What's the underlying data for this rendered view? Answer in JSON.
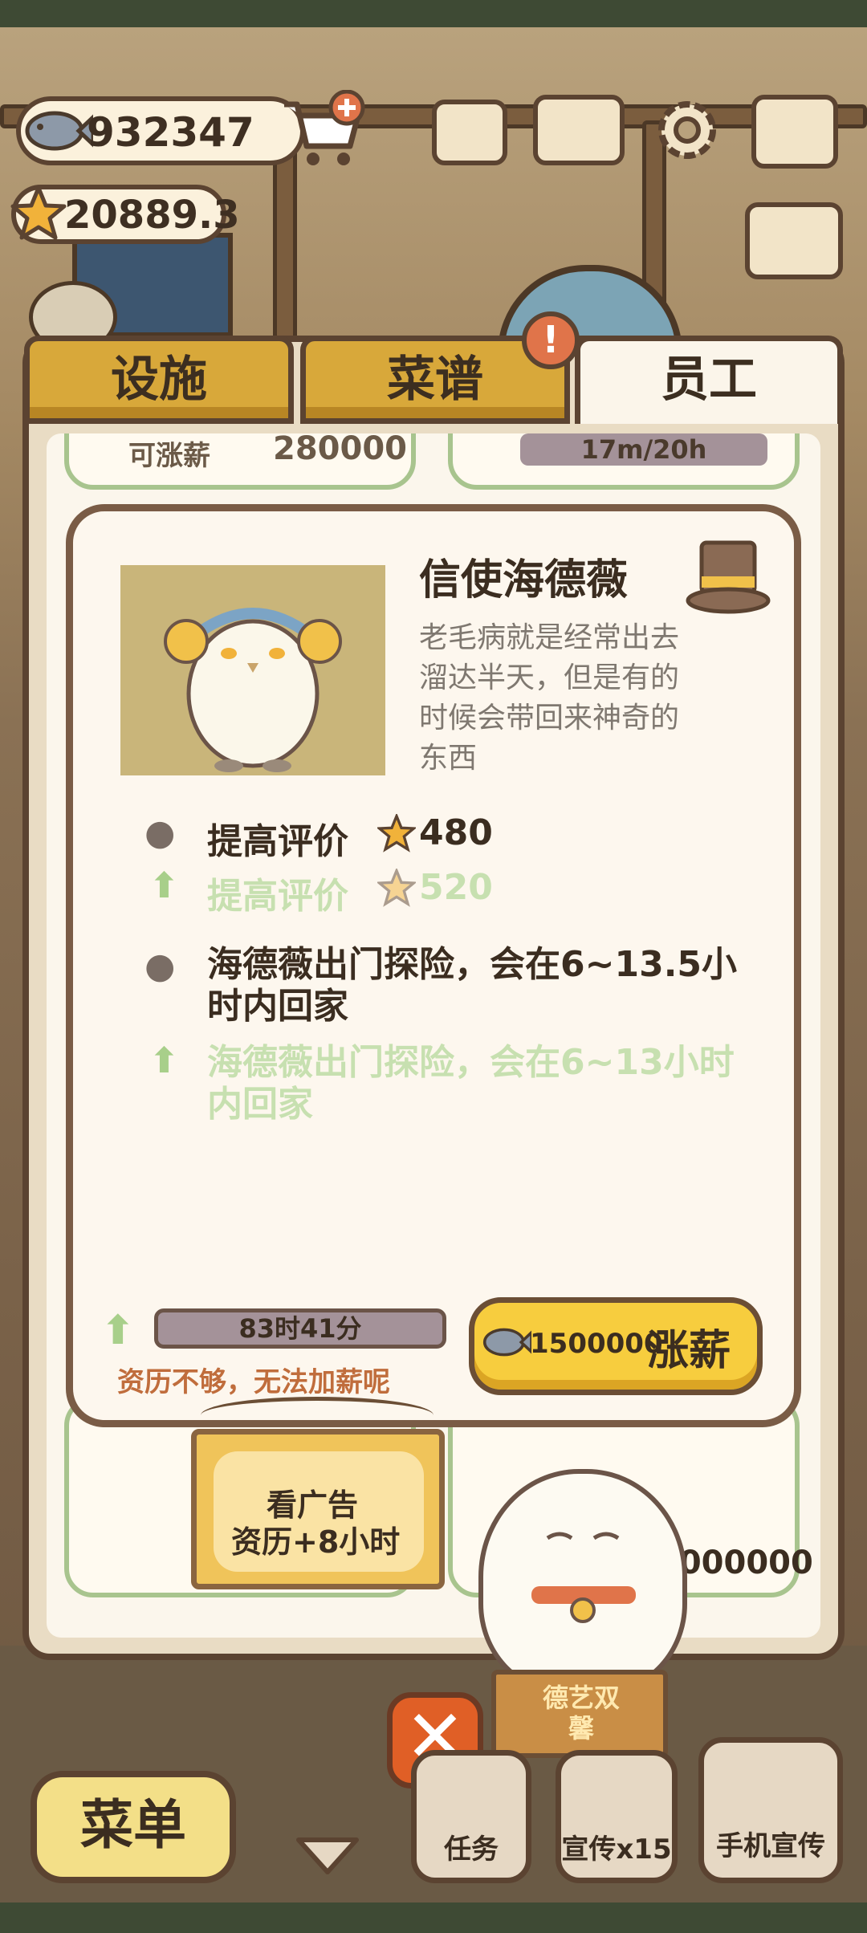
{
  "currency": {
    "fish": "932347",
    "stars": "20889.3"
  },
  "tabs": [
    {
      "label": "设施",
      "active": false
    },
    {
      "label": "菜谱",
      "active": false,
      "badge": "!"
    },
    {
      "label": "员工",
      "active": true
    }
  ],
  "list_peek": {
    "left_card_text": "可涨薪",
    "left_card_value": "280000",
    "right_card_time": "17m/20h",
    "right_bottom_value": "1000000"
  },
  "staff": {
    "name": "信使海德薇",
    "description": "老毛病就是经常出去溜达半天，但是有的时候会带回来神奇的东西",
    "effects": [
      {
        "label": "提高评价",
        "value": "480",
        "next_label": "提高评价",
        "next_value": "520"
      },
      {
        "label": "海德薇出门探险，会在6~13.5小时内回家",
        "next_label": "海德薇出门探险，会在6~13小时内回家"
      }
    ],
    "time_remaining": "83时41分",
    "warning": "资历不够，无法加薪呢",
    "raise": {
      "cost": "1500000",
      "label": "涨薪"
    }
  },
  "ad_scroll": {
    "line1": "看广告",
    "line2": "资历+8小时"
  },
  "mascot_sign": "德艺双馨",
  "bottom": {
    "menu": "菜单",
    "task": "任务",
    "promo": "宣传x15",
    "phone": "手机宣传"
  },
  "colors": {
    "accent": "#f7cd3e",
    "tab_inactive": "#d8a83a",
    "warning": "#c06d3c",
    "close": "#e05f26"
  }
}
